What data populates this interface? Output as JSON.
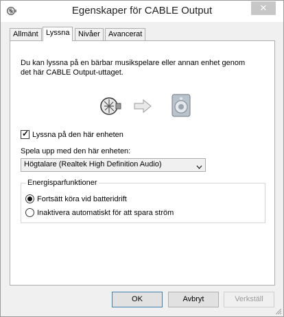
{
  "window": {
    "title": "Egenskaper för CABLE Output",
    "close_glyph": "✕"
  },
  "tabs": [
    {
      "label": "Allmänt",
      "active": false
    },
    {
      "label": "Lyssna",
      "active": true
    },
    {
      "label": "Nivåer",
      "active": false
    },
    {
      "label": "Avancerat",
      "active": false
    }
  ],
  "listen": {
    "description_line1": "Du kan lyssna på en bärbar musikspelare eller annan enhet genom",
    "description_line2": "det här CABLE Output-uttaget.",
    "listen_checkbox_label": "Lyssna på den här enheten",
    "listen_checked": true,
    "playback_label": "Spela upp med den här enheten:",
    "playback_device": "Högtalare (Realtek High Definition Audio)"
  },
  "power": {
    "title": "Energisparfunktioner",
    "option_continue": "Fortsätt köra vid batteridrift",
    "option_disable": "Inaktivera automatiskt för att spara ström",
    "selected": "continue"
  },
  "buttons": {
    "ok": "OK",
    "cancel": "Avbryt",
    "apply": "Verkställ"
  },
  "icons": {
    "title": "audio-cable-icon",
    "source": "audio-cable-icon",
    "arrow": "arrow-right-icon",
    "speaker": "speaker-icon"
  },
  "colors": {
    "accent": "#3c7fb1",
    "close_button": "#c7c7c7"
  }
}
